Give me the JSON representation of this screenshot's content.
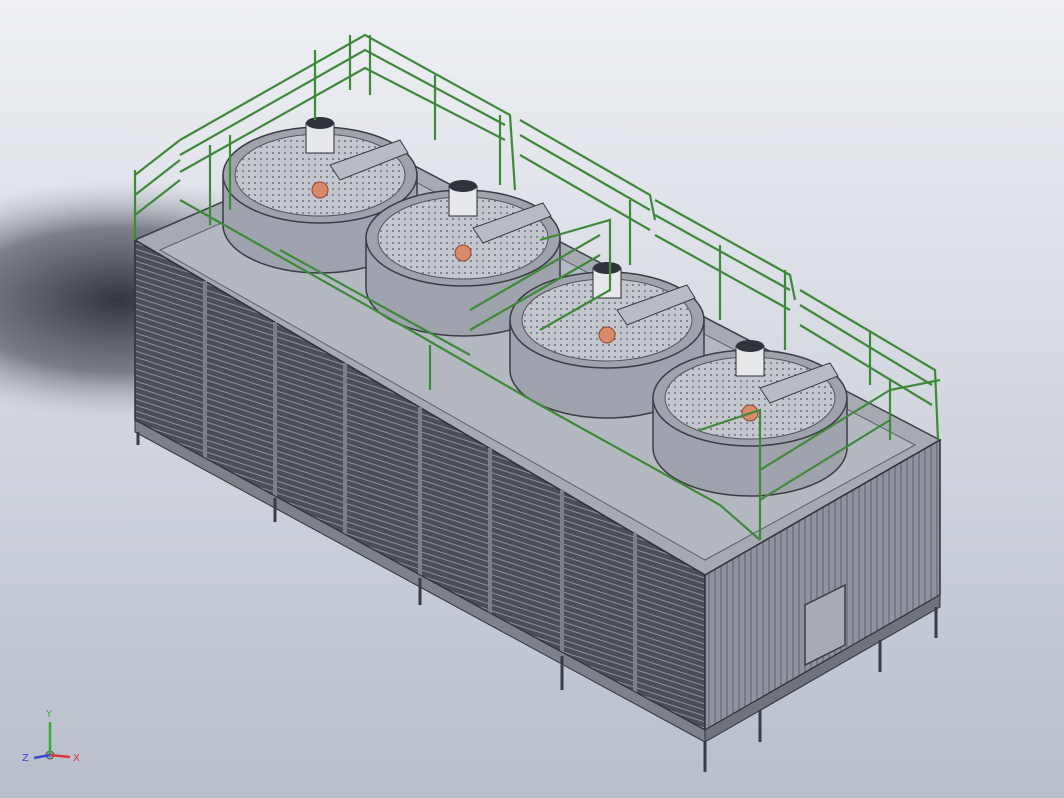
{
  "model": {
    "fan_count": 4,
    "colors": {
      "background_top": "#eef0f4",
      "background_bottom": "#b8bfcb",
      "casing": "#9ea3ad",
      "casing_dark": "#5f646e",
      "louver": "#3a3d44",
      "railing": "#3f8a3a",
      "fan_blade_hub": "#d98a6a",
      "motor": "#e7e8ea"
    }
  },
  "triad": {
    "x_label": "X",
    "y_label": "Y",
    "z_label": "Z",
    "x_color": "#d63a3a",
    "y_color": "#3aaa3a",
    "z_color": "#3a4ad6"
  }
}
